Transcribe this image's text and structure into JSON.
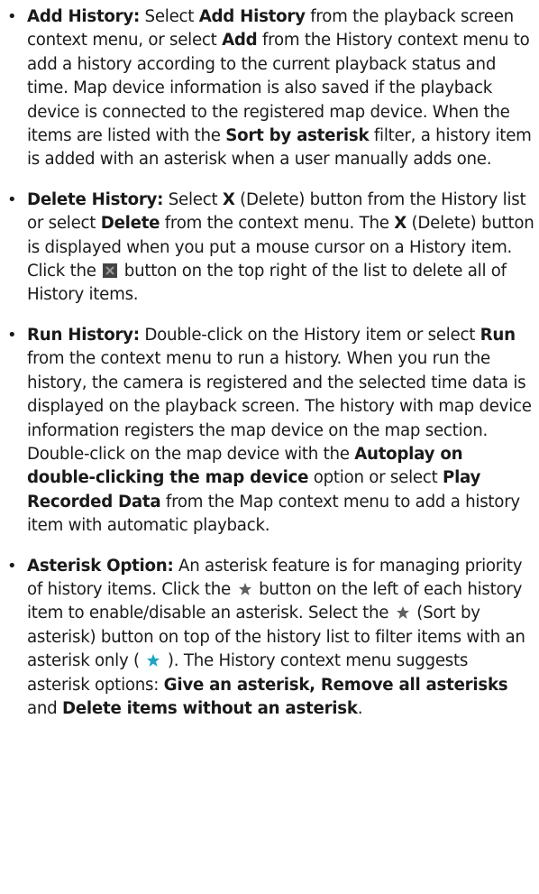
{
  "items": [
    {
      "bullet": "•",
      "parts": [
        {
          "t": "Add History:",
          "b": true
        },
        {
          "t": " Select "
        },
        {
          "t": "Add History",
          "b": true
        },
        {
          "t": " from the playback screen context menu, or select "
        },
        {
          "t": "Add",
          "b": true
        },
        {
          "t": " from the History context menu to add a history according to the current playback status  and time. Map device information is also saved if the playback device is connected to the registered map device. When the items are listed with the "
        },
        {
          "t": "Sort by asterisk",
          "b": true
        },
        {
          "t": " filter, a history item is added with an asterisk when a user manually adds one."
        }
      ]
    },
    {
      "bullet": "•",
      "parts": [
        {
          "t": "Delete History:",
          "b": true
        },
        {
          "t": " Select "
        },
        {
          "t": "X",
          "b": true
        },
        {
          "t": " (Delete) button from the History list or select "
        },
        {
          "t": "Delete",
          "b": true
        },
        {
          "t": " from the context menu. The "
        },
        {
          "t": "X",
          "b": true
        },
        {
          "t": " (Delete) button is displayed when you put a mouse cursor on a History item. Click the "
        },
        {
          "icon": "delete-all-icon"
        },
        {
          "t": " button on the top right of the list to delete all of History items."
        }
      ]
    },
    {
      "bullet": "•",
      "parts": [
        {
          "t": "Run History:",
          "b": true
        },
        {
          "t": " Double-click on the History item or select "
        },
        {
          "t": "Run",
          "b": true
        },
        {
          "t": " from the context menu to run a history. When you run the history, the camera is registered and the selected time data is displayed on the playback screen. The history with map device information registers the map device on the map section. Double-click on the map device with the "
        },
        {
          "t": "Autoplay on double-clicking the map device",
          "b": true
        },
        {
          "t": " option or select "
        },
        {
          "t": "Play Recorded Data",
          "b": true
        },
        {
          "t": " from the Map context menu to add a history item with automatic playback."
        }
      ]
    },
    {
      "bullet": "•",
      "parts": [
        {
          "t": "Asterisk Option:",
          "b": true
        },
        {
          "t": " An asterisk feature is for managing priority of history items. Click the "
        },
        {
          "icon": "star-grey-icon"
        },
        {
          "t": " button on the left of each history item to enable/disable an asterisk. Select the "
        },
        {
          "icon": "star-grey-icon"
        },
        {
          "t": " (Sort by asterisk) button on top of the history list to filter items with an asterisk only ( "
        },
        {
          "icon": "star-teal-icon"
        },
        {
          "t": " ). The History context menu suggests asterisk options: "
        },
        {
          "t": "Give an asterisk, Remove all asterisks",
          "b": true
        },
        {
          "t": " and "
        },
        {
          "t": "Delete items without an asterisk",
          "b": true
        },
        {
          "t": "."
        }
      ]
    }
  ],
  "colors": {
    "text": "#1a1a1a",
    "star_grey": "#5f5f5f",
    "star_teal": "#19a7c8",
    "delete_box": "#444444"
  }
}
